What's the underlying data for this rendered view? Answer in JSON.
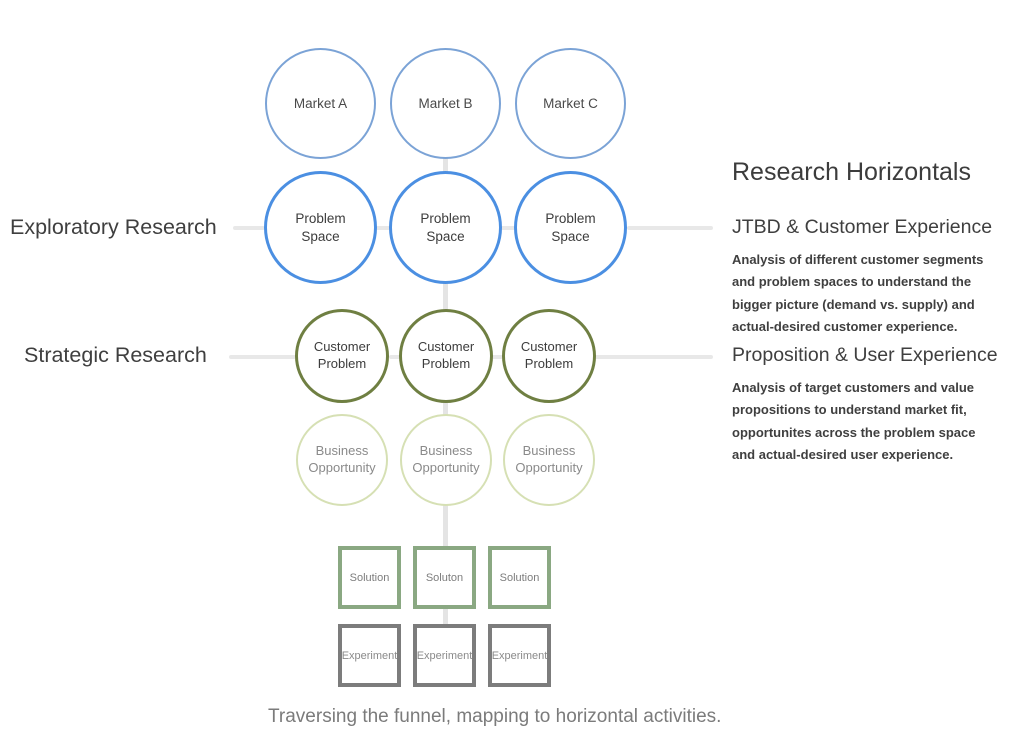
{
  "diagram": {
    "caption": "Traversing the funnel, mapping to horizontal activities.",
    "row_labels": {
      "exploratory": "Exploratory Research",
      "strategic": "Strategic Research"
    },
    "rows": {
      "market": [
        {
          "label": "Market A"
        },
        {
          "label": "Market B"
        },
        {
          "label": "Market C"
        }
      ],
      "problem_space": [
        {
          "line1": "Problem",
          "line2": "Space"
        },
        {
          "line1": "Problem",
          "line2": "Space"
        },
        {
          "line1": "Problem",
          "line2": "Space"
        }
      ],
      "customer_problem": [
        {
          "line1": "Customer",
          "line2": "Problem"
        },
        {
          "line1": "Customer",
          "line2": "Problem"
        },
        {
          "line1": "Customer",
          "line2": "Problem"
        }
      ],
      "business_opportunity": [
        {
          "line1": "Business",
          "line2": "Opportunity"
        },
        {
          "line1": "Business",
          "line2": "Opportunity"
        },
        {
          "line1": "Business",
          "line2": "Opportunity"
        }
      ],
      "solution": [
        {
          "label": "Solution"
        },
        {
          "label": "Soluton"
        },
        {
          "label": "Solution"
        }
      ],
      "experiment": [
        {
          "label": "Experiment"
        },
        {
          "label": "Experiment"
        },
        {
          "label": "Experiment"
        }
      ]
    }
  },
  "panel": {
    "title": "Research Horizontals",
    "sections": [
      {
        "heading": "JTBD & Customer Experience",
        "body": "Analysis of different customer segments and problem spaces to understand the bigger picture (demand vs. supply) and actual-desired customer experience."
      },
      {
        "heading": "Proposition & User Experience",
        "body": "Analysis of target customers and value propositions to understand market fit, opportunites across the problem space and actual-desired user experience."
      }
    ]
  },
  "colors": {
    "market_stroke": "#7ba3d6",
    "problem_stroke": "#4b8fe2",
    "customer_stroke": "#6f7f42",
    "business_stroke": "#d6e0b4",
    "solution_stroke": "#8aa882",
    "experiment_stroke": "#7c7c7c",
    "connector": "#e8e8e8"
  }
}
